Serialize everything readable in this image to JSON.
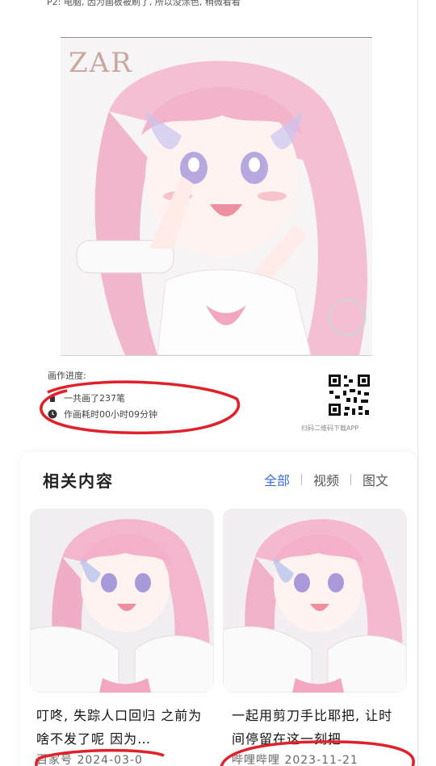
{
  "top_caption": "P2: 电脑, 因为画板被刷了, 所以没涂色, 稍微看看",
  "artwork": {
    "watermark": "ZAR",
    "progress_title": "画作进度:",
    "strokes_text": "一共画了237笔",
    "time_text": "作画耗时00小时09分钟",
    "qr_caption": "扫码二维码下载APP"
  },
  "related": {
    "title": "相关内容",
    "tabs": [
      {
        "label": "全部",
        "active": true
      },
      {
        "label": "视频",
        "active": false
      },
      {
        "label": "图文",
        "active": false
      }
    ],
    "items": [
      {
        "title": "叮咚, 失踪人口回归 之前为啥不发了呢 因为…",
        "source": "百家号",
        "date": "2024-03-0"
      },
      {
        "title": "一起用剪刀手比耶把, 让时间停留在这一刻把",
        "source": "哔哩哔哩",
        "date": "2023-11-21"
      }
    ]
  },
  "colors": {
    "accent": "#3b6fd8",
    "annotation": "#e0202a",
    "hair": "#f2b4cc"
  }
}
